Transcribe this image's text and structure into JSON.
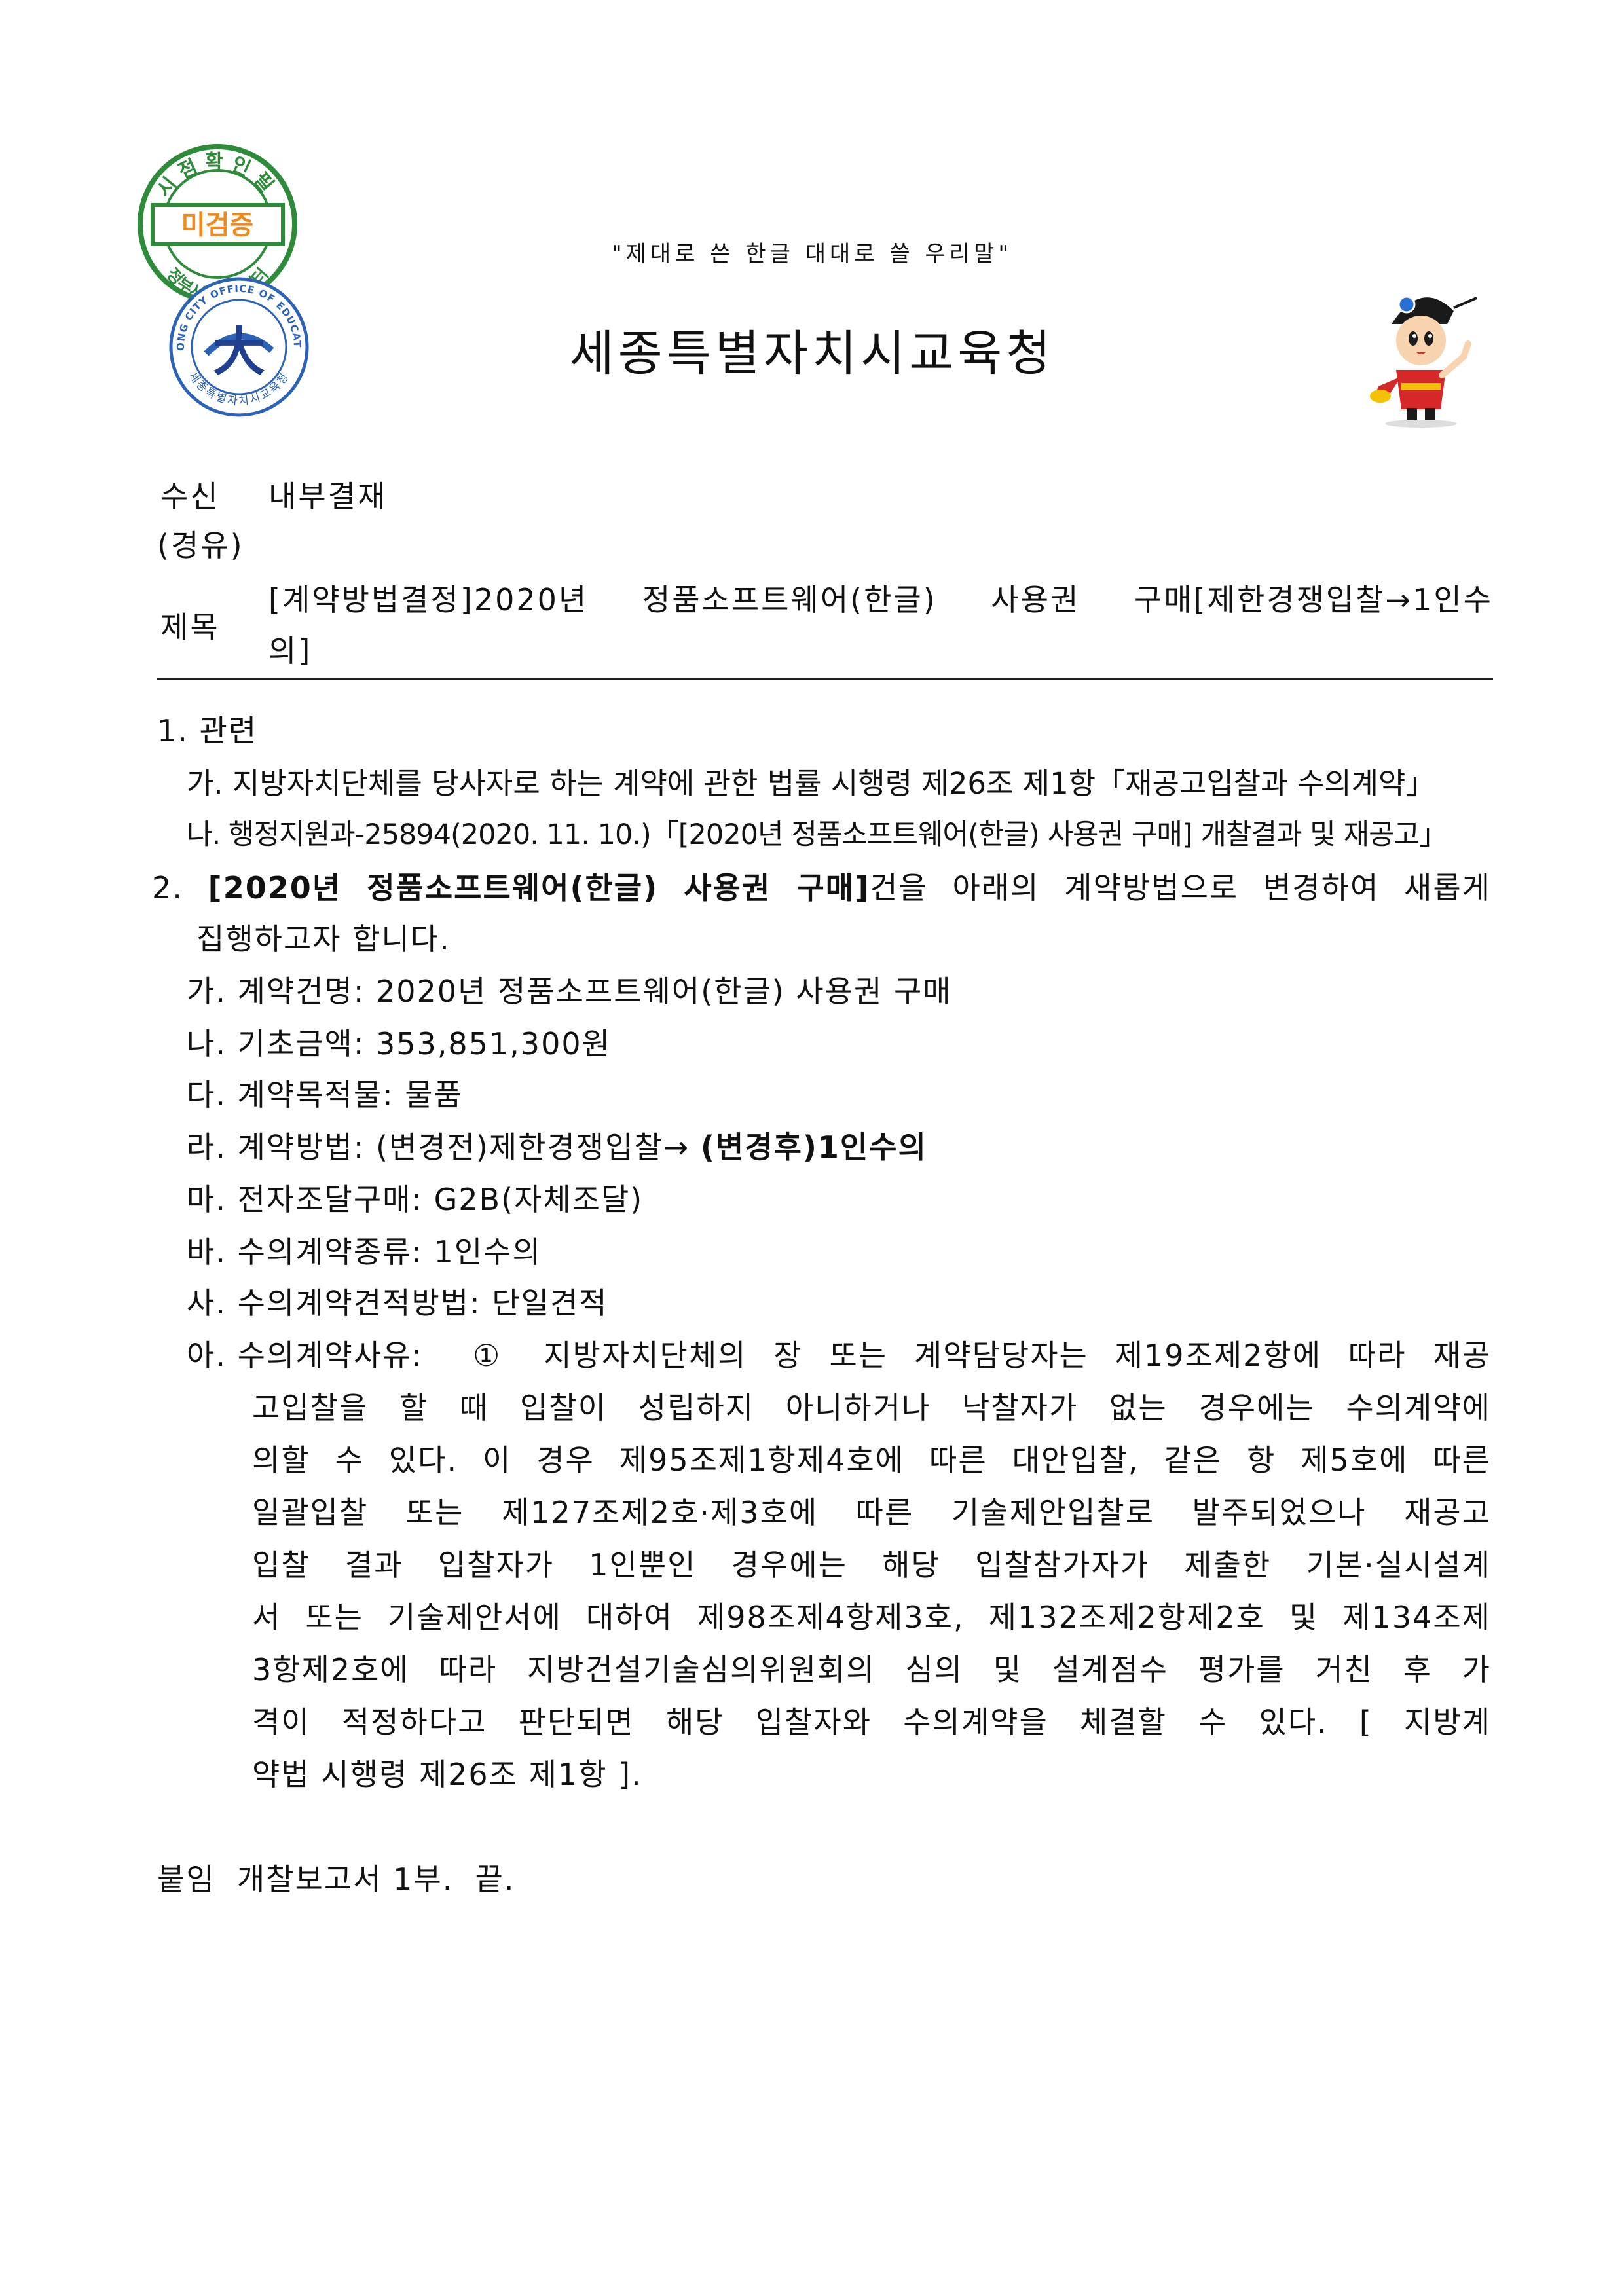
{
  "stamp": {
    "top_text": "시점확인필",
    "center_text": "미검증",
    "bottom_text": "정부시점확인센터"
  },
  "emblem": {
    "ring_text": "SEJONG CITY OFFICE OF EDUCATION",
    "inner_text": "세종특별자치시교육청",
    "glyph": "大"
  },
  "header": {
    "slogan": "\"제대로 쓴 한글 대대로 쓸 우리말\"",
    "organization": "세종특별자치시교육청"
  },
  "meta": {
    "recipient_label": "수신",
    "recipient_value": "내부결재",
    "via_label": "(경유)",
    "subject_label": "제목",
    "subject_line1": "[계약방법결정]2020년 정품소프트웨어(한글) 사용권 구매[제한경쟁입찰→1인수",
    "subject_line2": "의]"
  },
  "body": {
    "s1_title": "1. 관련",
    "s1_a": "가. 지방자치단체를 당사자로 하는 계약에 관한 법률 시행령 제26조 제1항「재공고입찰과 수의계약」",
    "s1_b": "나. 행정지원과-25894(2020. 11. 10.)「[2020년 정품소프트웨어(한글) 사용권 구매] 개찰결과 및 재공고」",
    "s2_prefix": "2.",
    "s2_bold": "[2020년 정품소프트웨어(한글) 사용권 구매]",
    "s2_rest": "건을 아래의 계약방법으로 변경하여 새롭게",
    "s2_line2": "집행하고자 합니다.",
    "items": [
      "가. 계약건명: 2020년 정품소프트웨어(한글) 사용권 구매",
      "나. 기초금액: 353,851,300원",
      "다. 계약목적물: 물품"
    ],
    "method_prefix": "라. 계약방법: (변경전)제한경쟁입찰→ ",
    "method_bold": "(변경후)1인수의",
    "items2": [
      "마. 전자조달구매: G2B(자체조달)",
      "바. 수의계약종류: 1인수의",
      "사. 수의계약견적방법: 단일견적"
    ],
    "reason_label": "아. 수의계약사유:",
    "reason_lines": [
      "① 지방자치단체의 장 또는 계약담당자는 제19조제2항에 따라 재공",
      "고입찰을 할 때 입찰이 성립하지 아니하거나 낙찰자가 없는 경우에는 수의계약에",
      "의할 수 있다. 이 경우 제95조제1항제4호에 따른 대안입찰, 같은 항 제5호에 따른",
      "일괄입찰 또는 제127조제2호·제3호에 따른 기술제안입찰로 발주되었으나 재공고",
      "입찰 결과 입찰자가 1인뿐인 경우에는 해당 입찰참가자가 제출한 기본·실시설계",
      "서 또는 기술제안서에 대하여 제98조제4항제3호, 제132조제2항제2호 및 제134조제",
      "3항제2호에 따라 지방건설기술심의위원회의 심의 및 설계점수 평가를 거친 후 가",
      "격이 적정하다고 판단되면 해당 입찰자와 수의계약을 체결할 수 있다. [ 지방계"
    ],
    "reason_last": "약법 시행령 제26조 제1항 ].",
    "attachment": "붙임  개찰보고서 1부.  끝."
  },
  "colors": {
    "stamp_green": "#2e8b3a",
    "stamp_orange": "#f08a1c",
    "emblem_blue": "#2c63b8",
    "text": "#111111"
  }
}
